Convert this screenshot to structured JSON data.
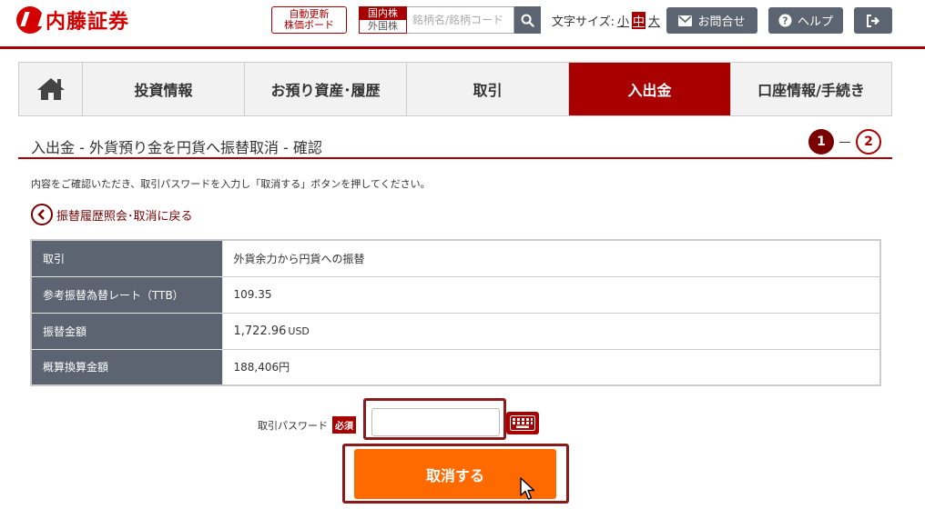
{
  "header": {
    "logo": "内藤証券",
    "board_line1": "自動更新",
    "board_line2": "株価ボード",
    "market_domestic": "国内株",
    "market_foreign": "外国株",
    "search_placeholder": "銘柄名/銘柄コード",
    "text_size_label": "文字サイズ:",
    "text_size_small": "小",
    "text_size_medium": "中",
    "text_size_large": "大",
    "contact": "お問合せ",
    "help": "ヘルプ"
  },
  "nav": {
    "items": [
      "投資情報",
      "お預り資産･履歴",
      "取引",
      "入出金",
      "口座情報/手続き"
    ]
  },
  "page": {
    "title": "入出金 - 外貨預り金を円貨へ振替取消 - 確認",
    "step1": "1",
    "step2": "2",
    "instruction": "内容をご確認いただき、取引パスワードを入力し「取消する」ボタンを押してください。",
    "back_link": "振替履歴照会･取消に戻る"
  },
  "table": {
    "rows": [
      {
        "label": "取引",
        "value": "外貨余力から円貨への振替"
      },
      {
        "label": "参考振替為替レート（TTB）",
        "value": "109.35"
      },
      {
        "label": "振替金額",
        "value": "1,722.96",
        "unit": "USD"
      },
      {
        "label": "概算換算金額",
        "value": "188,406円"
      }
    ]
  },
  "form": {
    "password_label": "取引パスワード",
    "required": "必須",
    "password_value": "",
    "submit": "取消する"
  },
  "colors": {
    "brand": "#a80000",
    "accent_button": "#ff6a00",
    "header_button": "#5b6470"
  }
}
